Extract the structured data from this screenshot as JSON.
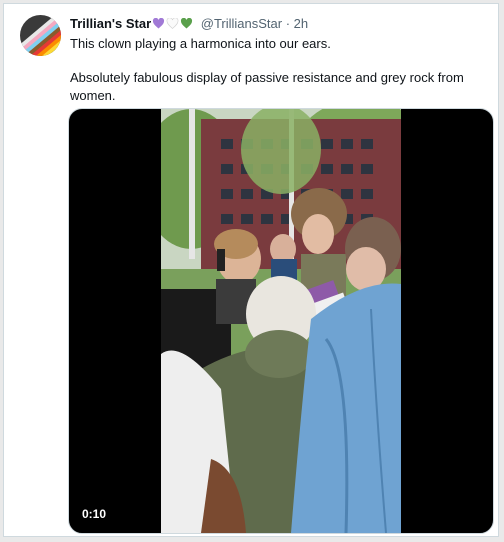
{
  "tweet": {
    "display_name": "Trillian's Star",
    "hearts": [
      "purple-heart",
      "white-heart",
      "green-heart"
    ],
    "handle_time": "@TrilliansStar · 2h",
    "text_line1": "This clown playing a harmonica into our ears.",
    "text_line2": "Absolutely fabulous display of passive resistance and grey rock from women."
  },
  "video": {
    "timestamp": "0:10"
  },
  "colors": {
    "text": "#0f1419",
    "secondary_text": "#536471",
    "border": "#cfd9de",
    "heart_purple": "#a17ad6",
    "heart_white": "#ffffff",
    "heart_green": "#5aa04c"
  }
}
